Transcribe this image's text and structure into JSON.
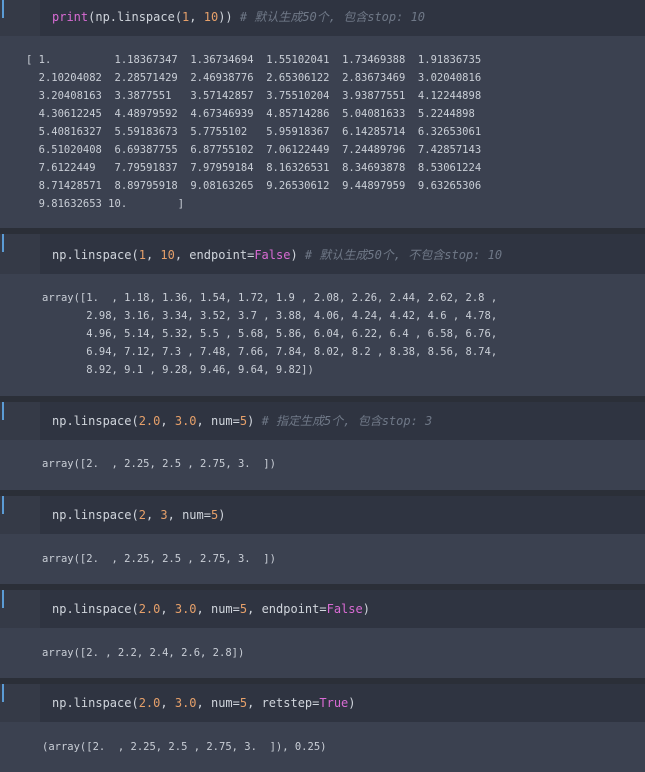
{
  "cells": [
    {
      "input_parts": [
        {
          "t": "print",
          "c": "kw"
        },
        {
          "t": "(np.linspace(",
          "c": "arg"
        },
        {
          "t": "1",
          "c": "num"
        },
        {
          "t": ", ",
          "c": "arg"
        },
        {
          "t": "10",
          "c": "num"
        },
        {
          "t": ")) ",
          "c": "arg"
        },
        {
          "t": "# 默认生成50个, 包含stop: 10",
          "c": "cm"
        }
      ],
      "output_lines": [
        "[ 1.          1.18367347  1.36734694  1.55102041  1.73469388  1.91836735",
        "  2.10204082  2.28571429  2.46938776  2.65306122  2.83673469  3.02040816",
        "  3.20408163  3.3877551   3.57142857  3.75510204  3.93877551  4.12244898",
        "  4.30612245  4.48979592  4.67346939  4.85714286  5.04081633  5.2244898",
        "  5.40816327  5.59183673  5.7755102   5.95918367  6.14285714  6.32653061",
        "  6.51020408  6.69387755  6.87755102  7.06122449  7.24489796  7.42857143",
        "  7.6122449   7.79591837  7.97959184  8.16326531  8.34693878  8.53061224",
        "  8.71428571  8.89795918  9.08163265  9.26530612  9.44897959  9.63265306",
        "  9.81632653 10.        ]"
      ]
    },
    {
      "input_parts": [
        {
          "t": "np.linspace(",
          "c": "arg"
        },
        {
          "t": "1",
          "c": "num"
        },
        {
          "t": ", ",
          "c": "arg"
        },
        {
          "t": "10",
          "c": "num"
        },
        {
          "t": ", endpoint=",
          "c": "arg"
        },
        {
          "t": "False",
          "c": "bool"
        },
        {
          "t": ") ",
          "c": "arg"
        },
        {
          "t": "# 默认生成50个, 不包含stop: 10",
          "c": "cm"
        }
      ],
      "output_lines": [
        "array([1.  , 1.18, 1.36, 1.54, 1.72, 1.9 , 2.08, 2.26, 2.44, 2.62, 2.8 ,",
        "       2.98, 3.16, 3.34, 3.52, 3.7 , 3.88, 4.06, 4.24, 4.42, 4.6 , 4.78,",
        "       4.96, 5.14, 5.32, 5.5 , 5.68, 5.86, 6.04, 6.22, 6.4 , 6.58, 6.76,",
        "       6.94, 7.12, 7.3 , 7.48, 7.66, 7.84, 8.02, 8.2 , 8.38, 8.56, 8.74,",
        "       8.92, 9.1 , 9.28, 9.46, 9.64, 9.82])"
      ]
    },
    {
      "input_parts": [
        {
          "t": "np.linspace(",
          "c": "arg"
        },
        {
          "t": "2.0",
          "c": "num"
        },
        {
          "t": ", ",
          "c": "arg"
        },
        {
          "t": "3.0",
          "c": "num"
        },
        {
          "t": ", num=",
          "c": "arg"
        },
        {
          "t": "5",
          "c": "num"
        },
        {
          "t": ") ",
          "c": "arg"
        },
        {
          "t": "# 指定生成5个, 包含stop: 3",
          "c": "cm"
        }
      ],
      "output_lines": [
        "array([2.  , 2.25, 2.5 , 2.75, 3.  ])"
      ]
    },
    {
      "input_parts": [
        {
          "t": "np.linspace(",
          "c": "arg"
        },
        {
          "t": "2",
          "c": "num"
        },
        {
          "t": ", ",
          "c": "arg"
        },
        {
          "t": "3",
          "c": "num"
        },
        {
          "t": ", num=",
          "c": "arg"
        },
        {
          "t": "5",
          "c": "num"
        },
        {
          "t": ")",
          "c": "arg"
        }
      ],
      "output_lines": [
        "array([2.  , 2.25, 2.5 , 2.75, 3.  ])"
      ]
    },
    {
      "input_parts": [
        {
          "t": "np.linspace(",
          "c": "arg"
        },
        {
          "t": "2.0",
          "c": "num"
        },
        {
          "t": ", ",
          "c": "arg"
        },
        {
          "t": "3.0",
          "c": "num"
        },
        {
          "t": ", num=",
          "c": "arg"
        },
        {
          "t": "5",
          "c": "num"
        },
        {
          "t": ", endpoint=",
          "c": "arg"
        },
        {
          "t": "False",
          "c": "bool"
        },
        {
          "t": ")",
          "c": "arg"
        }
      ],
      "output_lines": [
        "array([2. , 2.2, 2.4, 2.6, 2.8])"
      ]
    },
    {
      "input_parts": [
        {
          "t": "np.linspace(",
          "c": "arg"
        },
        {
          "t": "2.0",
          "c": "num"
        },
        {
          "t": ", ",
          "c": "arg"
        },
        {
          "t": "3.0",
          "c": "num"
        },
        {
          "t": ", num=",
          "c": "arg"
        },
        {
          "t": "5",
          "c": "num"
        },
        {
          "t": ", retstep=",
          "c": "arg"
        },
        {
          "t": "True",
          "c": "bool"
        },
        {
          "t": ")",
          "c": "arg"
        }
      ],
      "output_lines": [
        "(array([2.  , 2.25, 2.5 , 2.75, 3.  ]), 0.25)"
      ]
    }
  ]
}
